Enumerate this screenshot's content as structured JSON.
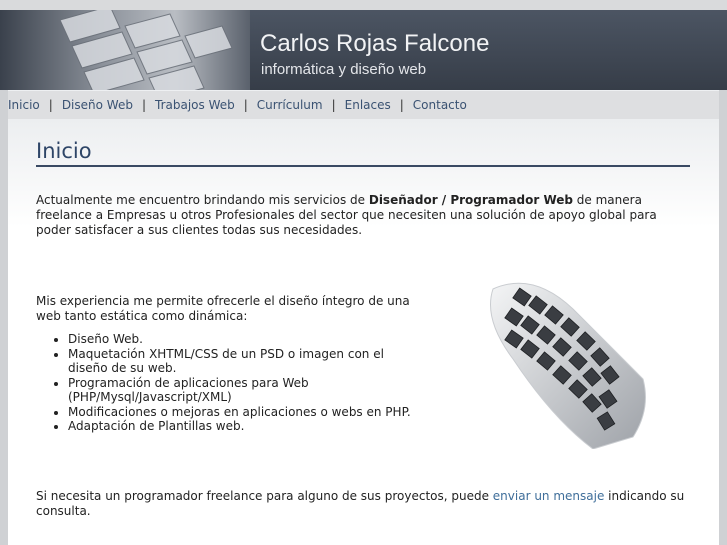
{
  "site": {
    "title": "Carlos Rojas Falcone",
    "subtitle": "informática y diseño web"
  },
  "nav": {
    "items": [
      "Inicio",
      "Diseño Web",
      "Trabajos Web",
      "Currículum",
      "Enlaces",
      "Contacto"
    ],
    "separator": "|"
  },
  "page": {
    "title": "Inicio",
    "intro_before": "Actualmente me encuentro brindando mis servicios de ",
    "intro_bold": "Diseñador / Programador Web",
    "intro_after": " de manera freelance a Empresas u otros Profesionales del sector que necesiten una solución de apoyo global para poder satisfacer a sus clientes todas sus necesidades.",
    "experience": "Mis experiencia me permite ofrecerle el diseño íntegro de una web tanto estática como dinámica:",
    "services": [
      "Diseño Web.",
      "Maquetación XHTML/CSS de un PSD o imagen con el diseño de su web.",
      "Programación de aplicaciones para Web (PHP/Mysql/Javascript/XML)",
      "Modificaciones o mejoras en aplicaciones o webs en PHP.",
      "Adaptación de Plantillas web."
    ],
    "contact_before": "Si necesita un programador freelance para alguno de sus proyectos, puede ",
    "contact_link": "enviar un mensaje",
    "contact_after": " indicando su consulta."
  },
  "icons": {
    "header_image": "keyboard-photo-icon",
    "content_image": "keyboard-icon"
  }
}
